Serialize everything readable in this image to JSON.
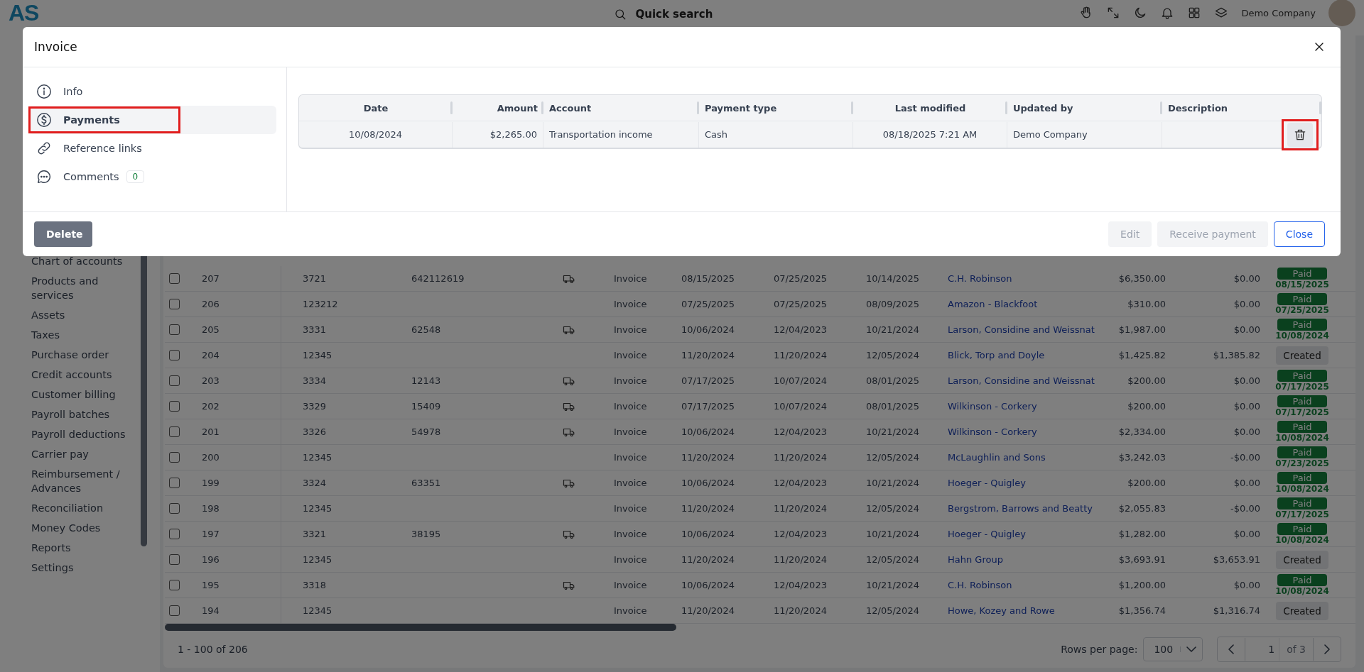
{
  "header": {
    "logo": "AS",
    "search": {
      "placeholder": "Quick search"
    },
    "company": "Demo Company"
  },
  "sidebar": {
    "items": [
      {
        "label": "Chart of accounts"
      },
      {
        "label": "Products and services"
      },
      {
        "label": "Assets"
      },
      {
        "label": "Taxes"
      },
      {
        "label": "Purchase order"
      },
      {
        "label": "Credit accounts"
      },
      {
        "label": "Customer billing"
      },
      {
        "label": "Payroll batches"
      },
      {
        "label": "Payroll deductions"
      },
      {
        "label": "Carrier pay"
      },
      {
        "label": "Reimbursement / Advances"
      },
      {
        "label": "Reconciliation"
      },
      {
        "label": "Money Codes"
      },
      {
        "label": "Reports"
      },
      {
        "label": "Settings"
      }
    ]
  },
  "table": {
    "rows": [
      {
        "checked": false,
        "column_2": "207",
        "column_3": "3721",
        "column_4": "642112619",
        "truck": true,
        "column_6": "Invoice",
        "column_7": "08/15/2025",
        "column_8": "07/25/2025",
        "column_9": "10/14/2025",
        "column_10": "C.H. Robinson",
        "column_11": "$6,350.00",
        "column_12": "$0.00",
        "status": {
          "kind": "paid",
          "label": "Paid",
          "date": "08/15/2025"
        }
      },
      {
        "checked": false,
        "column_2": "206",
        "column_3": "123212",
        "truck": false,
        "column_6": "Invoice",
        "column_7": "07/25/2025",
        "column_8": "07/25/2025",
        "column_9": "08/09/2025",
        "column_10": "Amazon - Blackfoot",
        "column_11": "$310.00",
        "column_12": "$0.00",
        "status": {
          "kind": "paid",
          "label": "Paid",
          "date": "07/25/2025"
        }
      },
      {
        "checked": false,
        "column_2": "205",
        "column_3": "3331",
        "column_4": "62548",
        "truck": true,
        "column_6": "Invoice",
        "column_7": "10/06/2024",
        "column_8": "12/04/2023",
        "column_9": "10/21/2024",
        "column_10": "Larson, Considine and Weissnat",
        "column_11": "$1,987.00",
        "column_12": "$0.00",
        "status": {
          "kind": "paid",
          "label": "Paid",
          "date": "10/08/2024"
        }
      },
      {
        "checked": false,
        "column_2": "204",
        "column_3": "12345",
        "truck": false,
        "column_6": "Invoice",
        "column_7": "11/20/2024",
        "column_8": "11/20/2024",
        "column_9": "12/05/2024",
        "column_10": "Blick, Torp and Doyle",
        "column_11": "$1,425.82",
        "column_12": "$1,385.82",
        "status": {
          "kind": "created",
          "label": "Created"
        }
      },
      {
        "checked": false,
        "column_2": "203",
        "column_3": "3334",
        "column_4": "12143",
        "truck": true,
        "column_6": "Invoice",
        "column_7": "07/17/2025",
        "column_8": "10/07/2024",
        "column_9": "08/01/2025",
        "column_10": "Larson, Considine and Weissnat",
        "column_11": "$200.00",
        "column_12": "$0.00",
        "status": {
          "kind": "paid",
          "label": "Paid",
          "date": "07/17/2025"
        }
      },
      {
        "checked": false,
        "column_2": "202",
        "column_3": "3329",
        "column_4": "15409",
        "truck": true,
        "column_6": "Invoice",
        "column_7": "07/17/2025",
        "column_8": "10/07/2024",
        "column_9": "08/01/2025",
        "column_10": "Wilkinson - Corkery",
        "column_11": "$200.00",
        "column_12": "$0.00",
        "status": {
          "kind": "paid",
          "label": "Paid",
          "date": "07/17/2025"
        }
      },
      {
        "checked": false,
        "column_2": "201",
        "column_3": "3326",
        "column_4": "54978",
        "truck": true,
        "column_6": "Invoice",
        "column_7": "10/06/2024",
        "column_8": "12/04/2023",
        "column_9": "10/21/2024",
        "column_10": "Wilkinson - Corkery",
        "column_11": "$2,334.00",
        "column_12": "$0.00",
        "status": {
          "kind": "paid",
          "label": "Paid",
          "date": "10/08/2024"
        }
      },
      {
        "checked": false,
        "column_2": "200",
        "column_3": "12345",
        "truck": false,
        "column_6": "Invoice",
        "column_7": "11/20/2024",
        "column_8": "11/20/2024",
        "column_9": "12/05/2024",
        "column_10": "McLaughlin and Sons",
        "column_11": "$3,242.03",
        "column_12": "-$0.00",
        "status": {
          "kind": "paid",
          "label": "Paid",
          "date": "07/23/2025"
        }
      },
      {
        "checked": false,
        "column_2": "199",
        "column_3": "3324",
        "column_4": "63351",
        "truck": true,
        "column_6": "Invoice",
        "column_7": "10/06/2024",
        "column_8": "12/04/2023",
        "column_9": "10/21/2024",
        "column_10": "Hoeger - Quigley",
        "column_11": "$200.00",
        "column_12": "$0.00",
        "status": {
          "kind": "paid",
          "label": "Paid",
          "date": "10/08/2024"
        }
      },
      {
        "checked": false,
        "column_2": "198",
        "column_3": "12345",
        "truck": false,
        "column_6": "Invoice",
        "column_7": "11/20/2024",
        "column_8": "11/20/2024",
        "column_9": "12/05/2024",
        "column_10": "Bergstrom, Barrows and Beatty",
        "column_11": "$2,055.83",
        "column_12": "-$0.00",
        "status": {
          "kind": "paid",
          "label": "Paid",
          "date": "07/17/2025"
        }
      },
      {
        "checked": false,
        "column_2": "197",
        "column_3": "3321",
        "column_4": "38195",
        "truck": true,
        "column_6": "Invoice",
        "column_7": "10/06/2024",
        "column_8": "12/04/2023",
        "column_9": "10/21/2024",
        "column_10": "Hoeger - Quigley",
        "column_11": "$1,282.00",
        "column_12": "$0.00",
        "status": {
          "kind": "paid",
          "label": "Paid",
          "date": "10/08/2024"
        }
      },
      {
        "checked": false,
        "column_2": "196",
        "column_3": "12345",
        "truck": false,
        "column_6": "Invoice",
        "column_7": "11/20/2024",
        "column_8": "11/20/2024",
        "column_9": "12/05/2024",
        "column_10": "Hahn Group",
        "column_11": "$3,693.91",
        "column_12": "$3,653.91",
        "status": {
          "kind": "created",
          "label": "Created"
        }
      },
      {
        "checked": false,
        "column_2": "195",
        "column_3": "3318",
        "truck": true,
        "column_6": "Invoice",
        "column_7": "10/06/2024",
        "column_8": "12/04/2023",
        "column_9": "10/21/2024",
        "column_10": "C.H. Robinson",
        "column_11": "$1,200.00",
        "column_12": "$0.00",
        "status": {
          "kind": "paid",
          "label": "Paid",
          "date": "10/08/2024"
        }
      },
      {
        "checked": false,
        "column_2": "194",
        "column_3": "12345",
        "truck": false,
        "column_6": "Invoice",
        "column_7": "11/20/2024",
        "column_8": "11/20/2024",
        "column_9": "12/05/2024",
        "column_10": "Howe, Kozey and Rowe",
        "column_11": "$1,356.74",
        "column_12": "$1,316.74",
        "status": {
          "kind": "created",
          "label": "Created"
        }
      }
    ],
    "footer": {
      "range": "1 - 100 of 206",
      "rows_per_page_label": "Rows per page:",
      "rows_per_page": "100",
      "page": "1",
      "page_count": "of 3"
    }
  },
  "modal": {
    "title": "Invoice",
    "nav": [
      {
        "kind": "info",
        "label": "Info",
        "selected": false,
        "highlighted": false
      },
      {
        "kind": "payments",
        "label": "Payments",
        "selected": true,
        "highlighted": true
      },
      {
        "kind": "links",
        "label": "Reference links",
        "selected": false,
        "highlighted": false
      },
      {
        "kind": "comments",
        "label": "Comments",
        "selected": false,
        "highlighted": false,
        "count": "0"
      }
    ],
    "payments": {
      "columns": [
        "Date",
        "Amount",
        "Account",
        "Payment type",
        "Last modified",
        "Updated by",
        "Description"
      ],
      "rows": [
        {
          "cells": [
            "10/08/2024",
            "$2,265.00",
            "Transportation income",
            "Cash",
            "08/18/2025 7:21 AM",
            "Demo Company"
          ],
          "delete_highlighted": true
        }
      ]
    },
    "buttons": [
      {
        "kind": "danger",
        "label": "Delete",
        "disabled": false
      },
      {
        "kind": "plain",
        "label": "Edit",
        "disabled": true
      },
      {
        "kind": "plain",
        "label": "Receive payment",
        "disabled": true
      },
      {
        "kind": "outline",
        "label": "Close",
        "disabled": false
      }
    ]
  }
}
